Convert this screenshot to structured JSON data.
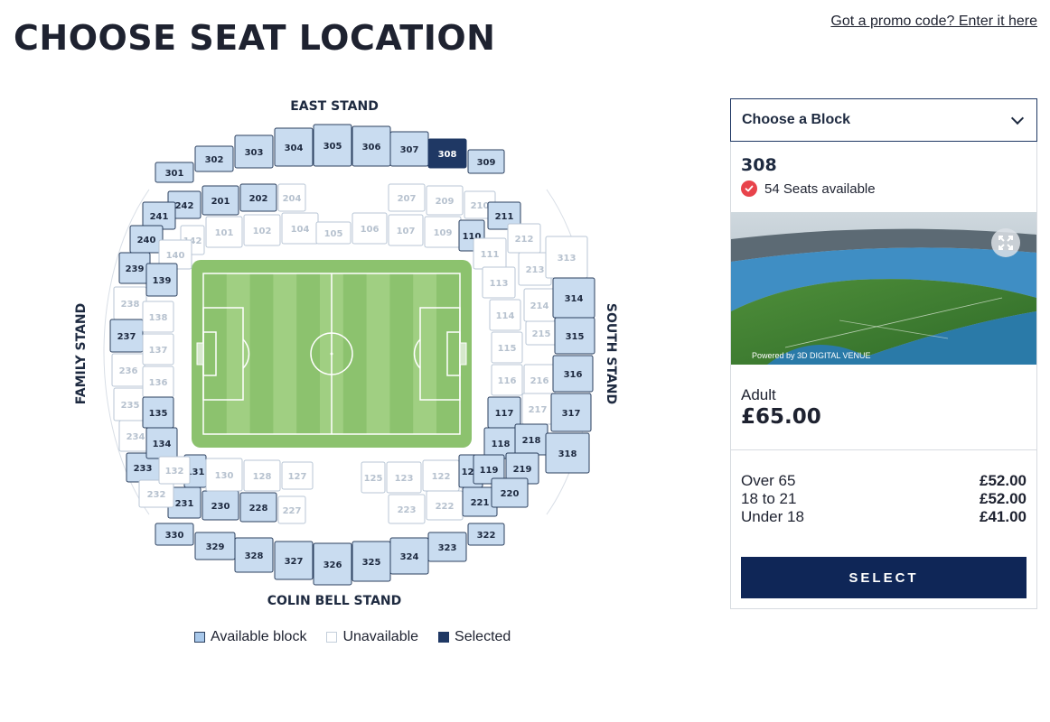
{
  "page": {
    "title": "CHOOSE SEAT LOCATION",
    "promo_link": "Got a promo code? Enter it here"
  },
  "colors": {
    "available": "#c9dcf0",
    "unavailable": "#ffffff",
    "selected": "#1f3864",
    "pitch": "#8cc26e",
    "button": "#0f2657",
    "check": "#e8434b"
  },
  "stands": {
    "east": "EAST STAND",
    "south": "SOUTH STAND",
    "colin_bell": "COLIN BELL STAND",
    "family": "FAMILY STAND"
  },
  "blocks": {
    "east_upper": [
      {
        "id": "301",
        "s": "a"
      },
      {
        "id": "302",
        "s": "a"
      },
      {
        "id": "303",
        "s": "a"
      },
      {
        "id": "304",
        "s": "a"
      },
      {
        "id": "305",
        "s": "a"
      },
      {
        "id": "306",
        "s": "a"
      },
      {
        "id": "307",
        "s": "a"
      },
      {
        "id": "308",
        "s": "s"
      },
      {
        "id": "309",
        "s": "a"
      }
    ],
    "east_middle": [
      {
        "id": "242",
        "s": "a"
      },
      {
        "id": "201",
        "s": "a"
      },
      {
        "id": "202",
        "s": "a"
      },
      {
        "id": "204",
        "s": "u"
      },
      {
        "id": "207",
        "s": "u"
      },
      {
        "id": "209",
        "s": "u"
      },
      {
        "id": "210",
        "s": "u"
      },
      {
        "id": "211",
        "s": "a"
      }
    ],
    "east_lower": [
      {
        "id": "142",
        "s": "u"
      },
      {
        "id": "101",
        "s": "u"
      },
      {
        "id": "102",
        "s": "u"
      },
      {
        "id": "104",
        "s": "u"
      },
      {
        "id": "105",
        "s": "u"
      },
      {
        "id": "106",
        "s": "u"
      },
      {
        "id": "107",
        "s": "u"
      },
      {
        "id": "109",
        "s": "u"
      },
      {
        "id": "110",
        "s": "a"
      }
    ],
    "colin_upper": [
      {
        "id": "330",
        "s": "a"
      },
      {
        "id": "329",
        "s": "a"
      },
      {
        "id": "328",
        "s": "a"
      },
      {
        "id": "327",
        "s": "a"
      },
      {
        "id": "326",
        "s": "a"
      },
      {
        "id": "325",
        "s": "a"
      },
      {
        "id": "324",
        "s": "a"
      },
      {
        "id": "323",
        "s": "a"
      },
      {
        "id": "322",
        "s": "a"
      }
    ],
    "colin_middle": [
      {
        "id": "231",
        "s": "a"
      },
      {
        "id": "230",
        "s": "a"
      },
      {
        "id": "228",
        "s": "a"
      },
      {
        "id": "227",
        "s": "u"
      },
      {
        "id": "223",
        "s": "u"
      },
      {
        "id": "222",
        "s": "u"
      },
      {
        "id": "221",
        "s": "a"
      }
    ],
    "colin_lower": [
      {
        "id": "131",
        "s": "a"
      },
      {
        "id": "130",
        "s": "u"
      },
      {
        "id": "128",
        "s": "u"
      },
      {
        "id": "127",
        "s": "u"
      },
      {
        "id": "125",
        "s": "u"
      },
      {
        "id": "123",
        "s": "u"
      },
      {
        "id": "122",
        "s": "u"
      },
      {
        "id": "121",
        "s": "a"
      }
    ],
    "family_outer": [
      {
        "id": "241",
        "s": "a"
      },
      {
        "id": "240",
        "s": "a"
      },
      {
        "id": "239",
        "s": "a"
      },
      {
        "id": "238",
        "s": "u"
      },
      {
        "id": "237",
        "s": "a"
      },
      {
        "id": "236",
        "s": "u"
      },
      {
        "id": "235",
        "s": "u"
      },
      {
        "id": "234",
        "s": "u"
      },
      {
        "id": "233",
        "s": "a"
      },
      {
        "id": "232",
        "s": "u"
      }
    ],
    "family_inner": [
      {
        "id": "140",
        "s": "u"
      },
      {
        "id": "139",
        "s": "a"
      },
      {
        "id": "138",
        "s": "u"
      },
      {
        "id": "137",
        "s": "u"
      },
      {
        "id": "136",
        "s": "u"
      },
      {
        "id": "135",
        "s": "a"
      },
      {
        "id": "134",
        "s": "a"
      },
      {
        "id": "132",
        "s": "u"
      }
    ],
    "south_lower": [
      {
        "id": "111",
        "s": "u"
      },
      {
        "id": "113",
        "s": "u"
      },
      {
        "id": "114",
        "s": "u"
      },
      {
        "id": "115",
        "s": "u"
      },
      {
        "id": "116",
        "s": "u"
      },
      {
        "id": "117",
        "s": "a"
      },
      {
        "id": "118",
        "s": "a"
      },
      {
        "id": "119",
        "s": "a"
      }
    ],
    "south_middle": [
      {
        "id": "212",
        "s": "u"
      },
      {
        "id": "213",
        "s": "u"
      },
      {
        "id": "214",
        "s": "u"
      },
      {
        "id": "215",
        "s": "u"
      },
      {
        "id": "216",
        "s": "u"
      },
      {
        "id": "217",
        "s": "u"
      },
      {
        "id": "218",
        "s": "a"
      },
      {
        "id": "219",
        "s": "a"
      },
      {
        "id": "220",
        "s": "a"
      }
    ],
    "south_upper": [
      {
        "id": "313",
        "s": "u"
      },
      {
        "id": "314",
        "s": "a"
      },
      {
        "id": "315",
        "s": "a"
      },
      {
        "id": "316",
        "s": "a"
      },
      {
        "id": "317",
        "s": "a"
      },
      {
        "id": "318",
        "s": "a"
      }
    ]
  },
  "legend": {
    "available": "Available block",
    "unavailable": "Unavailable",
    "selected": "Selected"
  },
  "panel": {
    "dropdown_label": "Choose a Block",
    "selected_block": "308",
    "availability": "54 Seats available",
    "view_caption": "Powered by 3D DIGITAL VENUE",
    "main_price": {
      "type": "Adult",
      "price": "£65.00"
    },
    "prices": [
      {
        "type": "Over 65",
        "price": "£52.00"
      },
      {
        "type": "18 to 21",
        "price": "£52.00"
      },
      {
        "type": "Under 18",
        "price": "£41.00"
      }
    ],
    "select_button": "SELECT"
  }
}
